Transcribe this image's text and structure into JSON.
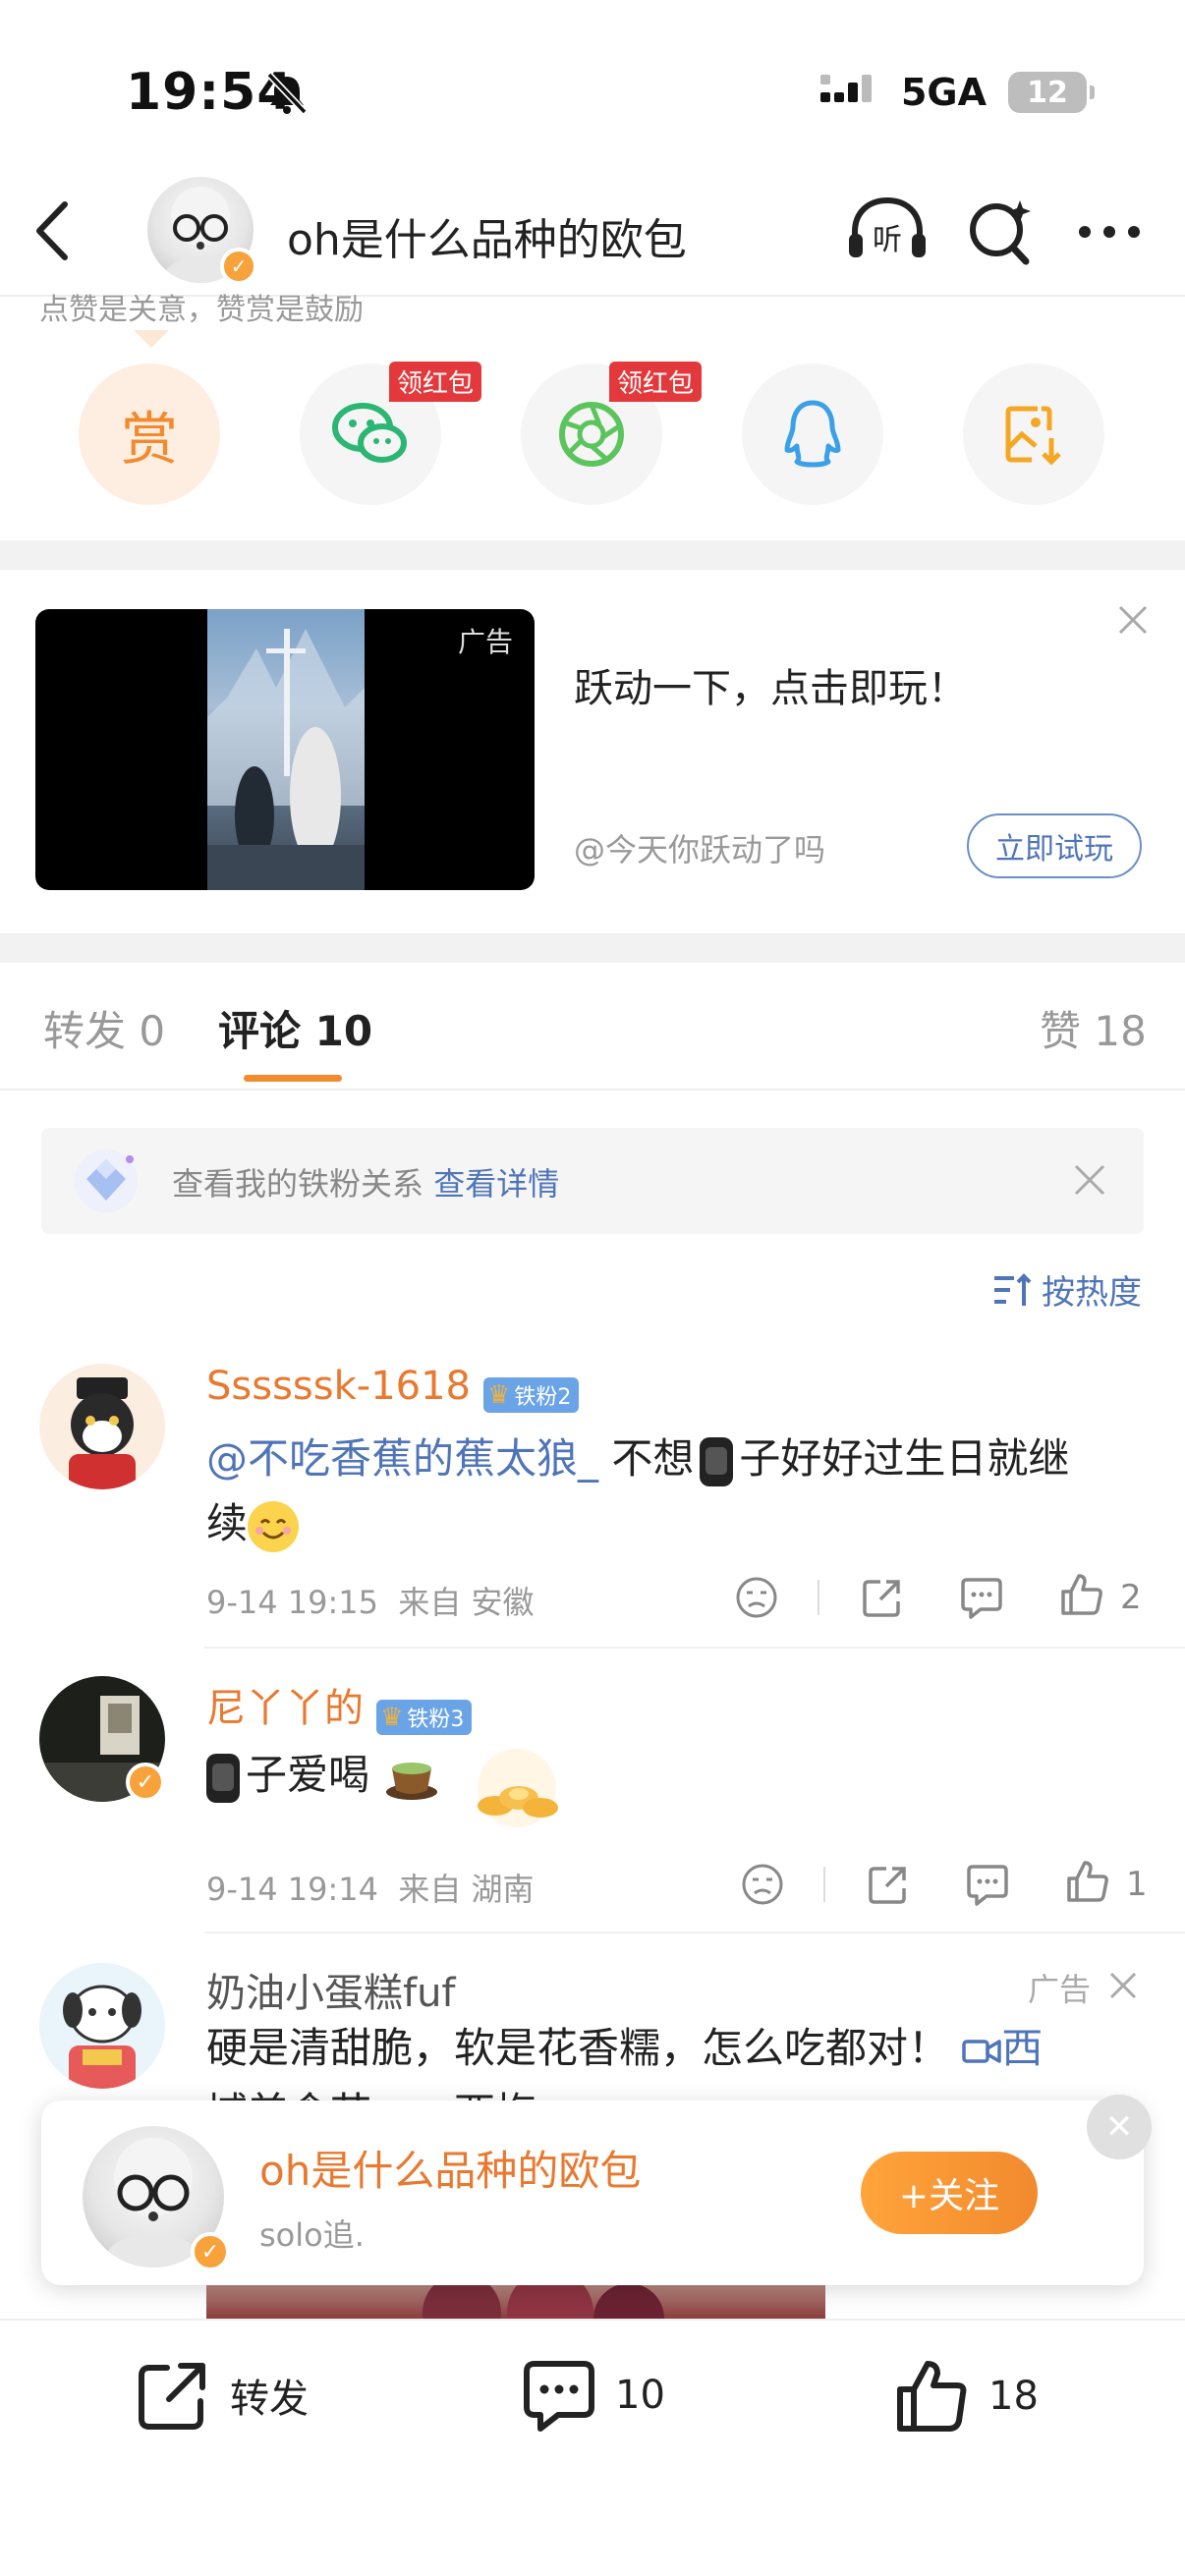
{
  "status_bar": {
    "time": "19:54",
    "network": "5GA",
    "battery": "12"
  },
  "header": {
    "title": "oh是什么品种的欧包"
  },
  "reward_row": {
    "hint": "点赞是关意，赞赏是鼓励",
    "reward_label": "赏",
    "tag1": "领红包",
    "tag2": "领红包"
  },
  "ad": {
    "corner_label": "广告",
    "headline": "跃动一下，点击即玩！",
    "source": "@今天你跃动了吗",
    "button": "立即试玩"
  },
  "tabs": {
    "repost": "转发 0",
    "comments": "评论 10",
    "likes": "赞 18"
  },
  "fan_bar": {
    "text": "查看我的铁粉关系",
    "link": "查看详情"
  },
  "sort": {
    "label": "按热度"
  },
  "comments": [
    {
      "name": "Ssssssk-1618",
      "badge": "铁粉2",
      "mention": "@不吃香蕉的蕉太狼_",
      "text_a": " 不想",
      "text_b": "子好好过生日就继",
      "text_c": "续",
      "time": "9-14 19:15",
      "location": "来自 安徽",
      "likes": "2"
    },
    {
      "name": "尼丫丫的",
      "badge": "铁粉3",
      "text_a": "子爱喝",
      "time": "9-14 19:14",
      "location": "来自 湖南",
      "likes": "1"
    },
    {
      "name": "奶油小蛋糕fuf",
      "ad_label": "广告",
      "text_a": "硬是清甜脆，软是花香糯，怎么吃都对！",
      "link": "西",
      "text_b": "域美食节——西梅"
    }
  ],
  "follow_popup": {
    "name": "oh是什么品种的欧包",
    "sub": "solo追.",
    "button": "+关注"
  },
  "bottom_bar": {
    "repost": "转发",
    "comments": "10",
    "likes": "18"
  },
  "colors": {
    "accent": "#f28a2e",
    "link": "#4f75b8",
    "verified": "#f7a23b"
  }
}
